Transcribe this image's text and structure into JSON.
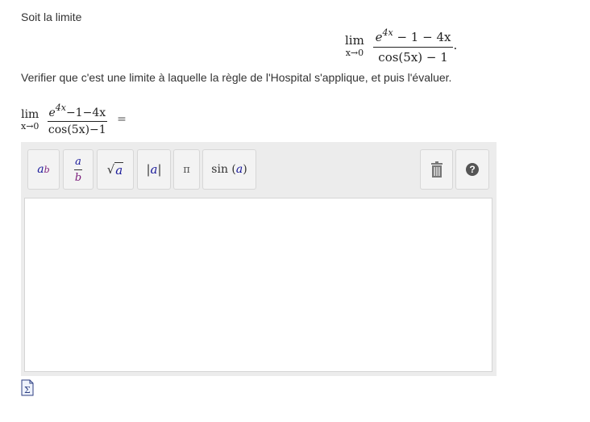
{
  "intro_text": "Soit la limite",
  "display_formula": {
    "lim": "lim",
    "lim_sub": "x→0",
    "numerator": {
      "base": "e",
      "exponent": "4x",
      "rest": " − 1 − 4x"
    },
    "denominator": "cos(5x) − 1",
    "trailing": "."
  },
  "question_text": "Verifier que c'est une limite à laquelle la règle de l'Hospital s'applique, et puis l'évaluer.",
  "answer_formula": {
    "lim": "lim",
    "lim_sub": "x→0",
    "numerator": {
      "base": "e",
      "exponent": "4x",
      "rest": "−1−4x"
    },
    "denominator": "cos(5x)−1",
    "equals": "="
  },
  "toolbar": {
    "power": {
      "base": "a",
      "exp": "b"
    },
    "fraction": {
      "num": "a",
      "den": "b"
    },
    "sqrt": {
      "symbol": "√",
      "arg": "a"
    },
    "abs": {
      "left": "|",
      "arg": "a",
      "right": "|"
    },
    "pi": "π",
    "sin": {
      "fn": "sin",
      "open": "(",
      "arg": "a",
      "close": ")"
    },
    "help": "?"
  },
  "icons": {
    "trash": "trash-icon",
    "help": "help-icon",
    "mathml": "mathml-icon"
  }
}
